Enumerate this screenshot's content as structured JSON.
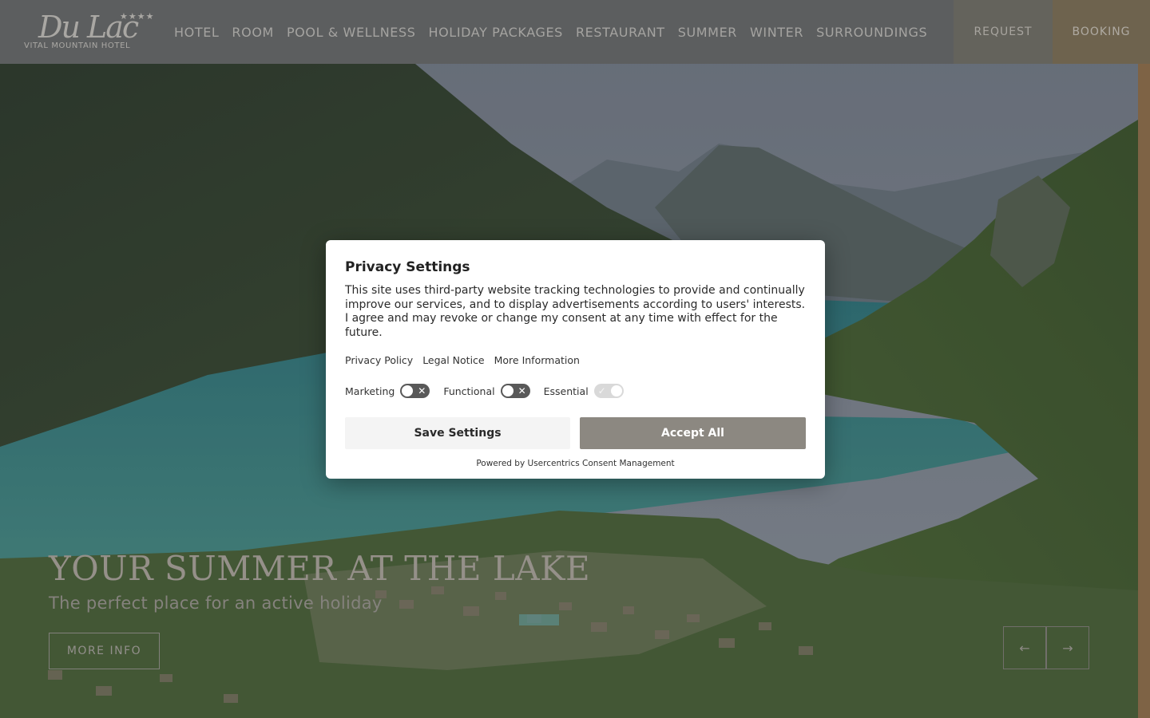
{
  "header": {
    "logo": {
      "script": "Du Lac",
      "stars": "★★★★",
      "subtitle": "VITAL MOUNTAIN HOTEL"
    },
    "nav": [
      "HOTEL",
      "ROOM",
      "POOL & WELLNESS",
      "HOLIDAY PACKAGES",
      "RESTAURANT",
      "SUMMER",
      "WINTER",
      "SURROUNDINGS"
    ],
    "request_label": "REQUEST",
    "booking_label": "BOOKING"
  },
  "hero": {
    "title": "YOUR SUMMER AT THE LAKE",
    "subtitle": "The perfect place for an active holiday",
    "more_info_label": "MORE INFO",
    "prev_arrow": "←",
    "next_arrow": "→"
  },
  "privacy_modal": {
    "title": "Privacy Settings",
    "text": "This site uses third-party website tracking technologies to provide and continually improve our services, and to display advertisements according to users' interests. I agree and may revoke or change my consent at any time with effect for the future.",
    "links": [
      "Privacy Policy",
      "Legal Notice",
      "More Information"
    ],
    "toggles": [
      {
        "label": "Marketing",
        "state": "off"
      },
      {
        "label": "Functional",
        "state": "off"
      },
      {
        "label": "Essential",
        "state": "on"
      }
    ],
    "save_label": "Save Settings",
    "accept_label": "Accept All",
    "powered_by": "Powered by Usercentrics Consent Management"
  },
  "colors": {
    "header_bg": "#707270",
    "booking_bg": "#8a7a5c",
    "accept_bg": "#8c8881",
    "lake": "#3f8e8c"
  }
}
